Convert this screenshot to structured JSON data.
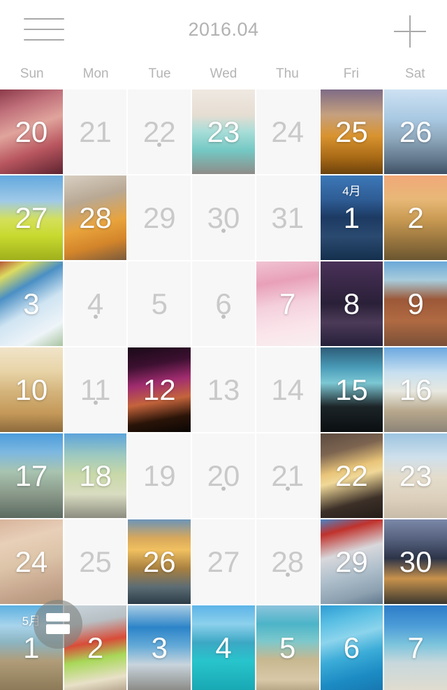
{
  "header": {
    "menu_icon": "hamburger-menu-icon",
    "title": "2016.04",
    "add_icon": "plus-icon"
  },
  "weekdays": [
    "Sun",
    "Mon",
    "Tue",
    "Wed",
    "Thu",
    "Fri",
    "Sat"
  ],
  "fab": {
    "icon": "layout-switch-icon"
  },
  "colors": {
    "background": "#ffffff",
    "empty_cell": "#f7f7f7",
    "muted_text": "#c9c9c9",
    "header_text": "#b2b2b2",
    "weekday_text": "#b4b4b4",
    "dot": "#c0c0c0",
    "photo_text": "#ffffff",
    "fab_bg": "rgba(128,130,128,0.62)"
  },
  "days": [
    {
      "num": "20",
      "photo": true,
      "dot": false,
      "monthtag": "",
      "grad": "linear-gradient(160deg,#8c3a4a 0%,#c0707a 22%,#e0a49c 45%,#b9565f 70%,#5d2430 100%)"
    },
    {
      "num": "21",
      "photo": false,
      "dot": false,
      "monthtag": "",
      "grad": ""
    },
    {
      "num": "22",
      "photo": false,
      "dot": true,
      "monthtag": "",
      "grad": ""
    },
    {
      "num": "23",
      "photo": true,
      "dot": false,
      "monthtag": "",
      "grad": "linear-gradient(180deg,#efe9e2 0%,#e6ddd2 30%,#a8ddd8 50%,#74c8c4 72%,#8e8c88 100%)"
    },
    {
      "num": "24",
      "photo": false,
      "dot": false,
      "monthtag": "",
      "grad": ""
    },
    {
      "num": "25",
      "photo": true,
      "dot": false,
      "monthtag": "",
      "grad": "linear-gradient(180deg,#7e6b86 0%,#c5a07e 30%,#d9932f 55%,#a96b16 80%,#6d420c 100%)"
    },
    {
      "num": "26",
      "photo": true,
      "dot": false,
      "monthtag": "",
      "grad": "linear-gradient(180deg,#cde1f2 0%,#a8c8e2 35%,#8ba4b8 60%,#5f7488 85%,#3f5164 100%)"
    },
    {
      "num": "27",
      "photo": true,
      "dot": false,
      "monthtag": "",
      "grad": "linear-gradient(180deg,#63a8dd 0%,#9fc9e8 30%,#d4e05a 52%,#c7d92e 72%,#9fb01c 100%)"
    },
    {
      "num": "28",
      "photo": true,
      "dot": false,
      "monthtag": "",
      "grad": "linear-gradient(165deg,#d8cfc2 0%,#b8a894 30%,#e8a33c 58%,#d4852a 78%,#7a5a3c 100%)"
    },
    {
      "num": "29",
      "photo": false,
      "dot": false,
      "monthtag": "",
      "grad": ""
    },
    {
      "num": "30",
      "photo": false,
      "dot": true,
      "monthtag": "",
      "grad": ""
    },
    {
      "num": "31",
      "photo": false,
      "dot": false,
      "monthtag": "",
      "grad": ""
    },
    {
      "num": "1",
      "photo": true,
      "dot": false,
      "monthtag": "4月",
      "grad": "linear-gradient(180deg,#3c78b8 0%,#2f5d96 28%,#1c3a62 50%,#2b4a70 72%,#14304e 100%)"
    },
    {
      "num": "2",
      "photo": true,
      "dot": false,
      "monthtag": "",
      "grad": "linear-gradient(180deg,#f0a878 0%,#e8b878 28%,#c99a52 52%,#9c7840 75%,#6b5630 100%)"
    },
    {
      "num": "3",
      "photo": true,
      "dot": false,
      "monthtag": "",
      "grad": "linear-gradient(150deg,#b85a38 0%,#dcdc60 14%,#4a8fc4 32%,#cfe4f2 55%,#eef4f8 80%,#a8c4a0 100%)"
    },
    {
      "num": "4",
      "photo": false,
      "dot": true,
      "monthtag": "",
      "grad": ""
    },
    {
      "num": "5",
      "photo": false,
      "dot": false,
      "monthtag": "",
      "grad": ""
    },
    {
      "num": "6",
      "photo": false,
      "dot": true,
      "monthtag": "",
      "grad": ""
    },
    {
      "num": "7",
      "photo": true,
      "dot": false,
      "monthtag": "",
      "grad": "linear-gradient(170deg,#f0c4d2 0%,#e8a0b8 25%,#f4d0dc 50%,#fae4ea 75%,#f8eef0 100%)"
    },
    {
      "num": "8",
      "photo": true,
      "dot": false,
      "monthtag": "",
      "grad": "linear-gradient(180deg,#4a3258 0%,#3a2848 25%,#2a2038 50%,#4c3a58 72%,#26203a 100%)"
    },
    {
      "num": "9",
      "photo": true,
      "dot": false,
      "monthtag": "",
      "grad": "linear-gradient(180deg,#6ba8d8 0%,#a8ccdc 22%,#9c5838 45%,#b06a42 70%,#7a5038 100%)"
    },
    {
      "num": "10",
      "photo": true,
      "dot": false,
      "monthtag": "",
      "grad": "linear-gradient(180deg,#f0e4c8 0%,#e8d4a8 28%,#d4b47c 52%,#c49858 78%,#8c6a3c 100%)"
    },
    {
      "num": "11",
      "photo": false,
      "dot": true,
      "monthtag": "",
      "grad": ""
    },
    {
      "num": "12",
      "photo": true,
      "dot": false,
      "monthtag": "",
      "grad": "linear-gradient(170deg,#1a0a18 0%,#3c1030 22%,#a02c70 42%,#c4643c 62%,#2a1408 82%,#0a0604 100%)"
    },
    {
      "num": "13",
      "photo": false,
      "dot": false,
      "monthtag": "",
      "grad": ""
    },
    {
      "num": "14",
      "photo": false,
      "dot": false,
      "monthtag": "",
      "grad": ""
    },
    {
      "num": "15",
      "photo": true,
      "dot": false,
      "monthtag": "",
      "grad": "linear-gradient(180deg,#2c5c78 0%,#4a9cb8 24%,#7cc8d4 42%,#1c2428 70%,#0a0e10 100%)"
    },
    {
      "num": "16",
      "photo": true,
      "dot": false,
      "monthtag": "",
      "grad": "linear-gradient(180deg,#6ba8e0 0%,#c8e0f0 30%,#e8e8e0 52%,#b8a88c 75%,#8c8478 100%)"
    },
    {
      "num": "17",
      "photo": true,
      "dot": false,
      "monthtag": "",
      "grad": "linear-gradient(180deg,#4a9cdc 0%,#7cb8e0 22%,#a8c4b0 45%,#8c9c8c 70%,#5c6a60 100%)"
    },
    {
      "num": "18",
      "photo": true,
      "dot": false,
      "monthtag": "",
      "grad": "linear-gradient(180deg,#5ca4dc 0%,#9cc8c0 25%,#c8d8a8 48%,#d8dcc0 72%,#8c8c80 100%)"
    },
    {
      "num": "19",
      "photo": false,
      "dot": false,
      "monthtag": "",
      "grad": ""
    },
    {
      "num": "20",
      "photo": false,
      "dot": true,
      "monthtag": "",
      "grad": ""
    },
    {
      "num": "21",
      "photo": false,
      "dot": true,
      "monthtag": "",
      "grad": ""
    },
    {
      "num": "22",
      "photo": true,
      "dot": false,
      "monthtag": "",
      "grad": "linear-gradient(165deg,#5c4a40 0%,#7c6450 22%,#e8c478 42%,#f0d898 52%,#3c3028 78%,#241c18 100%)"
    },
    {
      "num": "23",
      "photo": true,
      "dot": false,
      "monthtag": "",
      "grad": "linear-gradient(180deg,#9cc4e0 0%,#cfe0ec 28%,#e4dccc 52%,#dcd0bc 78%,#c8bca8 100%)"
    },
    {
      "num": "24",
      "photo": true,
      "dot": false,
      "monthtag": "",
      "grad": "linear-gradient(165deg,#d8b49c 0%,#e8cfb8 25%,#dcc4a8 50%,#c8a890 75%,#b09478 100%)"
    },
    {
      "num": "25",
      "photo": false,
      "dot": false,
      "monthtag": "",
      "grad": ""
    },
    {
      "num": "26",
      "photo": true,
      "dot": false,
      "monthtag": "",
      "grad": "linear-gradient(180deg,#6c94b8 0%,#d8a85c 22%,#f0c060 36%,#a88040 58%,#5c6c74 80%,#2c3c48 100%)"
    },
    {
      "num": "27",
      "photo": false,
      "dot": false,
      "monthtag": "",
      "grad": ""
    },
    {
      "num": "28",
      "photo": false,
      "dot": true,
      "monthtag": "",
      "grad": ""
    },
    {
      "num": "29",
      "photo": true,
      "dot": false,
      "monthtag": "",
      "grad": "linear-gradient(165deg,#4a84c4 0%,#c0322c 16%,#d8d8dc 40%,#b0c0cc 62%,#8ca0b0 85%,#60788c 100%)"
    },
    {
      "num": "30",
      "photo": true,
      "dot": false,
      "monthtag": "",
      "grad": "linear-gradient(180deg,#7c88a8 0%,#54607c 24%,#2c3448 46%,#c8924c 70%,#3c3830 100%)"
    },
    {
      "num": "1",
      "photo": true,
      "dot": false,
      "monthtag": "5月",
      "grad": "linear-gradient(180deg,#5cb0e0 0%,#a8d4ec 24%,#8cb4c0 44%,#b09c78 66%,#8c7a58 100%)"
    },
    {
      "num": "2",
      "photo": true,
      "dot": false,
      "monthtag": "",
      "grad": "linear-gradient(170deg,#c8d4dc 0%,#b8c0c4 22%,#d84c38 44%,#a8d858 62%,#e8e0c8 85%,#b8a890 100%)"
    },
    {
      "num": "3",
      "photo": true,
      "dot": false,
      "monthtag": "",
      "grad": "linear-gradient(180deg,#a8cce4 0%,#2c84c8 26%,#64aad8 48%,#c8d4dc 70%,#8c8c88 100%)"
    },
    {
      "num": "4",
      "photo": true,
      "dot": false,
      "monthtag": "",
      "grad": "linear-gradient(180deg,#5cb4e8 0%,#8cd0ec 22%,#3ca8c4 44%,#28c4cc 66%,#18a8b4 100%)"
    },
    {
      "num": "5",
      "photo": true,
      "dot": false,
      "monthtag": "",
      "grad": "linear-gradient(180deg,#8cc4dc 0%,#4cb4c8 22%,#7cc8cc 42%,#c8b890 64%,#d8c8a8 88%,#b8a888 100%)"
    },
    {
      "num": "6",
      "photo": true,
      "dot": false,
      "monthtag": "",
      "grad": "linear-gradient(165deg,#2c9cd4 0%,#5cc0e4 20%,#8cd4ec 38%,#3cacd8 58%,#1c8cc4 80%,#1878b0 100%)"
    },
    {
      "num": "7",
      "photo": true,
      "dot": false,
      "monthtag": "",
      "grad": "linear-gradient(180deg,#2c7cc8 0%,#4c9cd8 24%,#7cc4dc 46%,#c8d8dc 68%,#e0dcd0 100%)"
    }
  ]
}
